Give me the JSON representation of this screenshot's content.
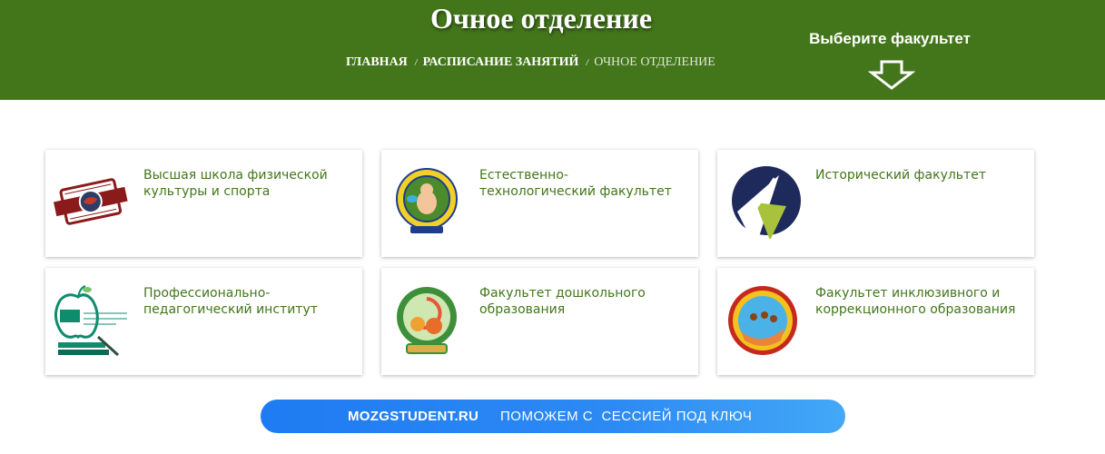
{
  "header": {
    "title": "Очное отделение",
    "breadcrumb": {
      "home": "ГЛАВНАЯ",
      "separator": "/",
      "schedule": "РАСПИСАНИЕ ЗАНЯТИЙ",
      "current": "ОЧНОЕ ОТДЕЛЕНИЕ"
    },
    "hint": "Выберите факультет"
  },
  "faculties": [
    {
      "title": "Высшая школа физической культуры и спорта",
      "icon": "sports-school-logo-icon"
    },
    {
      "title": "Естественно-технологический факультет",
      "icon": "natural-tech-faculty-logo-icon"
    },
    {
      "title": "Исторический факультет",
      "icon": "history-faculty-logo-icon"
    },
    {
      "title": "Профессионально-педагогический институт",
      "icon": "pedagogical-institute-logo-icon"
    },
    {
      "title": "Факультет дошкольного образования",
      "icon": "preschool-faculty-logo-icon"
    },
    {
      "title": "Факультет инклюзивного и коррекционного образования",
      "icon": "inclusive-faculty-logo-icon"
    }
  ],
  "banner": {
    "brand": "MOZGSTUDENT.RU",
    "slogan": "ПОМОЖЕМ С  СЕССИЕЙ ПОД КЛЮЧ"
  },
  "colors": {
    "header_bg": "#43761b",
    "card_text": "#43761b",
    "banner_blue": "#1f7bf2"
  }
}
